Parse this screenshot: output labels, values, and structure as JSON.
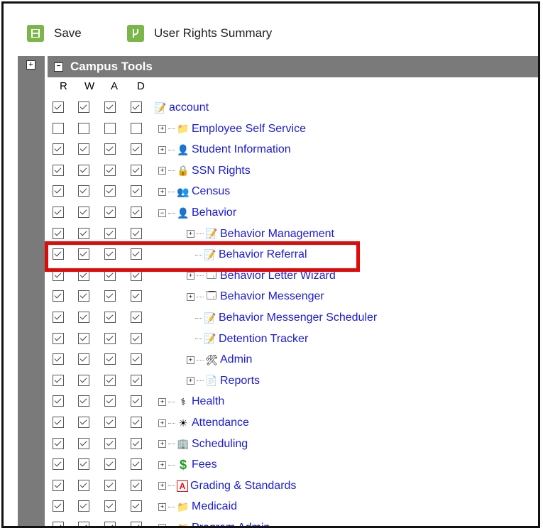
{
  "toolbar": {
    "save_label": "Save",
    "summary_label": "User Rights Summary",
    "save_icon": "save-icon",
    "summary_icon": "branch-icon"
  },
  "section": {
    "title": "Campus Tools"
  },
  "columns": [
    "R",
    "W",
    "A",
    "D"
  ],
  "tree": [
    {
      "label": "account",
      "icon": "account-icon",
      "checked": true,
      "level": 0,
      "expander": "none"
    },
    {
      "label": "Employee Self Service",
      "icon": "folder-icon",
      "checked": false,
      "level": 1,
      "expander": "plus"
    },
    {
      "label": "Student Information",
      "icon": "student-icon",
      "checked": true,
      "level": 1,
      "expander": "plus"
    },
    {
      "label": "SSN Rights",
      "icon": "lock-icon",
      "checked": true,
      "level": 1,
      "expander": "plus"
    },
    {
      "label": "Census",
      "icon": "census-icon",
      "checked": true,
      "level": 1,
      "expander": "plus"
    },
    {
      "label": "Behavior",
      "icon": "behavior-icon",
      "checked": true,
      "level": 1,
      "expander": "minus"
    },
    {
      "label": "Behavior Management",
      "icon": "note-icon",
      "checked": true,
      "level": 2,
      "expander": "plus"
    },
    {
      "label": "Behavior Referral",
      "icon": "note-icon",
      "checked": true,
      "level": 2,
      "expander": "none"
    },
    {
      "label": "Behavior Letter Wizard",
      "icon": "window-icon",
      "checked": true,
      "level": 2,
      "expander": "plus"
    },
    {
      "label": "Behavior Messenger",
      "icon": "window-icon",
      "checked": true,
      "level": 2,
      "expander": "plus"
    },
    {
      "label": "Behavior Messenger Scheduler",
      "icon": "note-icon",
      "checked": true,
      "level": 2,
      "expander": "none"
    },
    {
      "label": "Detention Tracker",
      "icon": "note-icon",
      "checked": true,
      "level": 2,
      "expander": "none"
    },
    {
      "label": "Admin",
      "icon": "admin-icon",
      "checked": true,
      "level": 2,
      "expander": "plus"
    },
    {
      "label": "Reports",
      "icon": "document-icon",
      "checked": true,
      "level": 2,
      "expander": "plus"
    },
    {
      "label": "Health",
      "icon": "health-icon",
      "checked": true,
      "level": 1,
      "expander": "plus"
    },
    {
      "label": "Attendance",
      "icon": "attendance-icon",
      "checked": true,
      "level": 1,
      "expander": "plus"
    },
    {
      "label": "Scheduling",
      "icon": "scheduling-icon",
      "checked": true,
      "level": 1,
      "expander": "plus"
    },
    {
      "label": "Fees",
      "icon": "fees-icon",
      "checked": true,
      "level": 1,
      "expander": "plus"
    },
    {
      "label": "Grading & Standards",
      "icon": "grading-icon",
      "checked": true,
      "level": 1,
      "expander": "plus"
    },
    {
      "label": "Medicaid",
      "icon": "folder-icon",
      "checked": true,
      "level": 1,
      "expander": "plus"
    },
    {
      "label": "Program Admin",
      "icon": "folder-icon",
      "checked": true,
      "level": 1,
      "expander": "plus"
    }
  ],
  "highlight_color": "#e10a0a",
  "link_color": "#1a1adb",
  "header_color": "#7a7a7a"
}
